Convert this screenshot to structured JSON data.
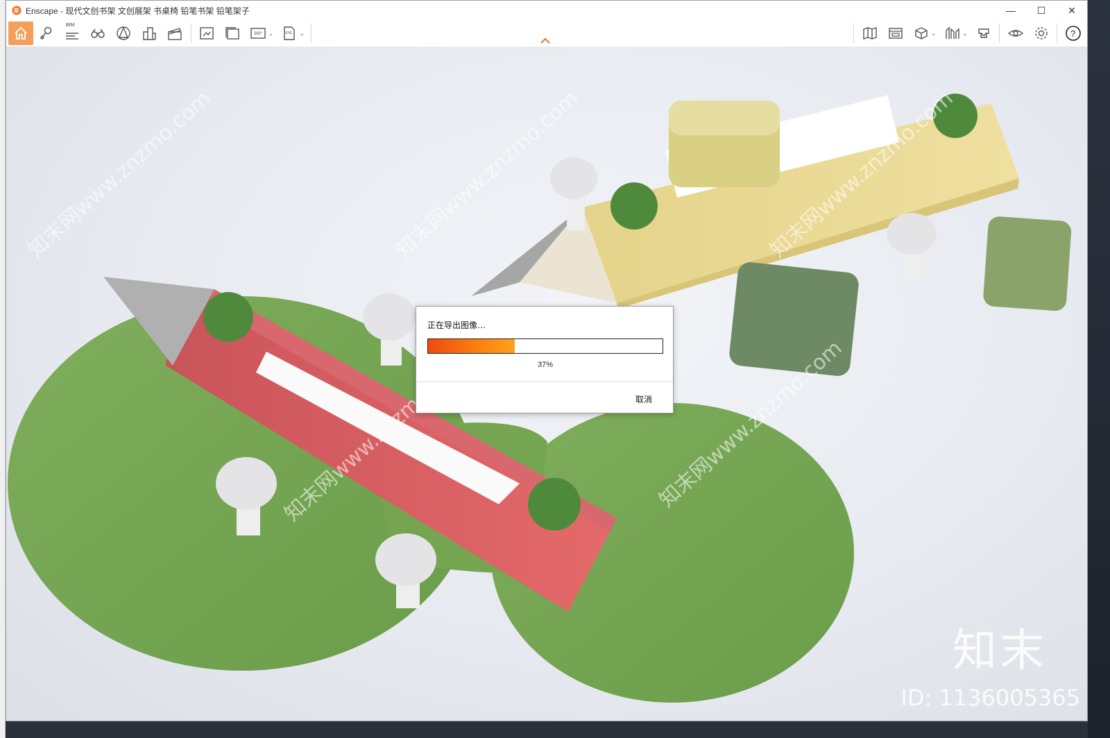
{
  "window": {
    "app_name": "Enscape",
    "title": "Enscape - 现代文创书架 文创展架 书桌椅 铅笔书架 铅笔架子",
    "controls": {
      "minimize": "—",
      "maximize": "☐",
      "close": "✕"
    }
  },
  "toolbar": {
    "bim_label": "BIM",
    "left_icons": [
      "home-icon",
      "location-pin-icon",
      "bim-icon",
      "binoculars-icon",
      "perspective-icon",
      "buildings-icon",
      "clapperboard-icon",
      "screenshot-icon",
      "batch-render-icon",
      "panorama-360-icon",
      "export-exe-icon"
    ],
    "right_icons": [
      "map-icon",
      "asset-library-icon",
      "view-cube-icon",
      "site-context-icon",
      "vr-headset-icon",
      "visibility-eye-icon",
      "settings-gear-icon",
      "help-icon"
    ],
    "accent_color": "#f5a05a",
    "pano_label": "360°",
    "exe_label": "EXE"
  },
  "dialog": {
    "title": "正在导出图像…",
    "progress_percent": 37,
    "progress_text": "37%",
    "cancel_label": "取消"
  },
  "watermark": {
    "logo_text": "知末",
    "id_text": "ID: 1136005365",
    "diagonal_text": "知末网www.znzmo.com"
  }
}
